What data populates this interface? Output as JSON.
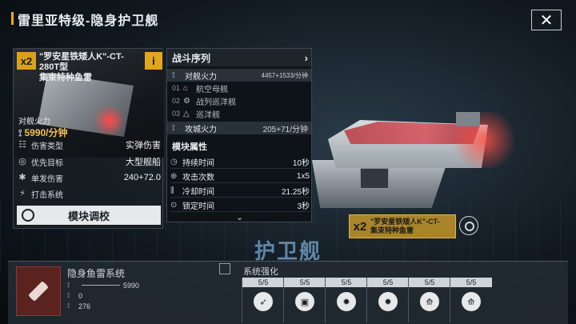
{
  "header": {
    "title": "雷里亚特级-隐身护卫舰",
    "close_label": "✕"
  },
  "card": {
    "badge": "x2",
    "name_line1": "\"罗安星铁矮人K\"-CT-280T型",
    "name_line2": "集束特种鱼雷",
    "info": "i",
    "firepower_label": "对舰火力",
    "firepower_value": "5990/分钟",
    "stats": [
      {
        "label": "伤害类型",
        "value": "实弹伤害",
        "icon": "damage-type-icon"
      },
      {
        "label": "优先目标",
        "value": "大型舰船",
        "icon": "target-icon"
      },
      {
        "label": "单发伤害",
        "value": "240+72.0",
        "icon": "single-damage-icon"
      },
      {
        "label": "打击系统",
        "value": "",
        "icon": "strike-system-icon"
      }
    ],
    "upgrade_label": "模块调校"
  },
  "panel": {
    "combat_title": "战斗序列",
    "antiship_label": "对舰火力",
    "antiship_value": "4457+1533/分钟",
    "targets": [
      {
        "num": "01",
        "label": "航空母舰"
      },
      {
        "num": "02",
        "label": "战列巡洋舰"
      },
      {
        "num": "03",
        "label": "巡洋舰"
      }
    ],
    "siege_label": "攻城火力",
    "siege_value": "205+71/分钟",
    "attrs_title": "模块属性",
    "attrs": [
      {
        "label": "持续时间",
        "value": "10秒"
      },
      {
        "label": "攻击次数",
        "value": "1x5"
      },
      {
        "label": "冷却时间",
        "value": "21.25秒"
      },
      {
        "label": "锁定时间",
        "value": "3秒"
      }
    ]
  },
  "tag": {
    "x2": "x2",
    "line1": "\"罗安星铁矮人K\"-CT-",
    "line2": "集束特种鱼雷"
  },
  "ship_class": "护卫舰",
  "bottom": {
    "system_name": "隐身鱼雷系统",
    "stats": [
      {
        "value": "5990"
      },
      {
        "value": "0"
      },
      {
        "value": "276"
      }
    ],
    "reinforce_title": "系统强化",
    "slots": [
      {
        "level": "5/5",
        "icon": "missile-icon"
      },
      {
        "level": "5/5",
        "icon": "chip-icon"
      },
      {
        "level": "5/5",
        "icon": "explosion-icon"
      },
      {
        "level": "5/5",
        "icon": "explosion-icon"
      },
      {
        "level": "5/5",
        "icon": "torpedo-icon"
      },
      {
        "level": "5/5",
        "icon": "torpedo-icon"
      }
    ]
  },
  "colors": {
    "accent": "#f0a91e",
    "highlight": "#f0c24a"
  }
}
